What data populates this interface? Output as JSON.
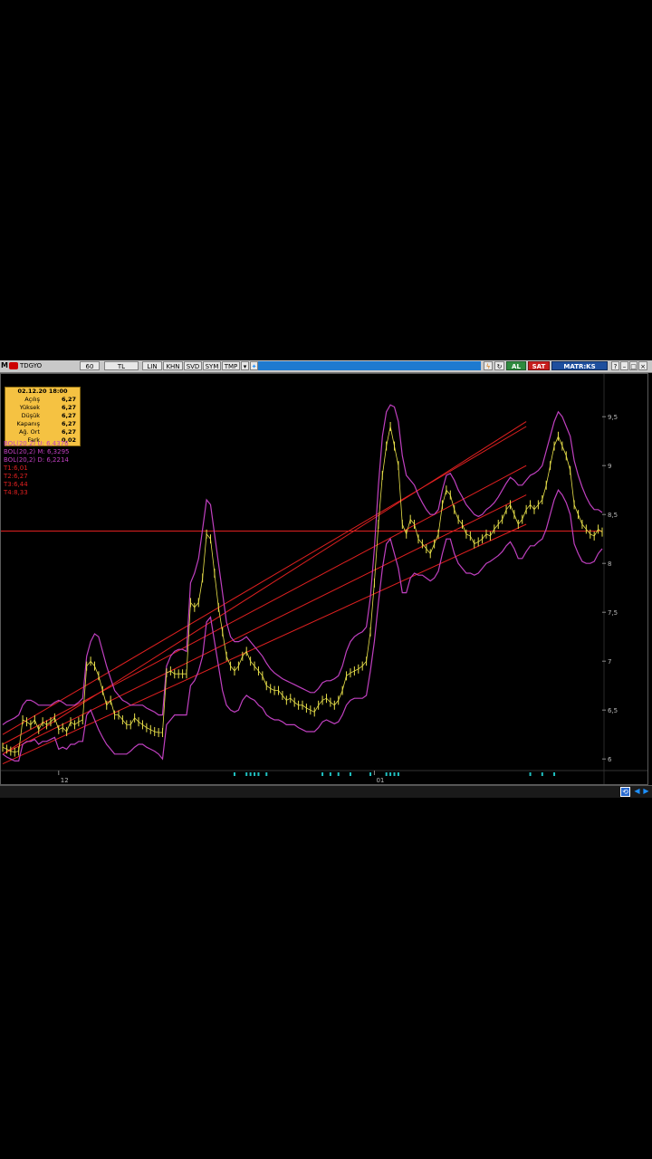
{
  "toolbar": {
    "symbol": "TDGYO",
    "period": "60",
    "currency": "TL",
    "buttons": [
      "LIN",
      "KHN",
      "SVD",
      "SYM",
      "TMP"
    ],
    "al": "AL",
    "sat": "SAT",
    "matrks": "MATR:KS"
  },
  "infobox": {
    "date": "02.12.20 18:00",
    "rows": [
      {
        "k": "Açılış",
        "v": "6,27"
      },
      {
        "k": "Yüksek",
        "v": "6,27"
      },
      {
        "k": "Düşük",
        "v": "6,27"
      },
      {
        "k": "Kapanış",
        "v": "6,27"
      },
      {
        "k": "Ağ. Ort",
        "v": "6,27"
      },
      {
        "k": "Fark",
        "v": "0,02"
      }
    ]
  },
  "indicators": [
    {
      "label": "BOL(20,2) U:",
      "value": "6,4376",
      "color": "#c040c0"
    },
    {
      "label": "BOL(20,2) M:",
      "value": "6,3295",
      "color": "#c040c0"
    },
    {
      "label": "BOL(20,2) D:",
      "value": "6,2214",
      "color": "#c040c0"
    },
    {
      "label": "T1:",
      "value": "6,01",
      "color": "#e02020"
    },
    {
      "label": "T2:",
      "value": "6,27",
      "color": "#e02020"
    },
    {
      "label": "T3:",
      "value": "6,44",
      "color": "#e02020"
    },
    {
      "label": "T4:",
      "value": "8,33",
      "color": "#e02020"
    }
  ],
  "chart_data": {
    "type": "line",
    "ylim": [
      5.9,
      9.9
    ],
    "yticks": [
      "9,5",
      "9",
      "8,5",
      "8",
      "7,5",
      "7",
      "6,5",
      "6"
    ],
    "ytick_values": [
      9.5,
      9.0,
      8.5,
      8.0,
      7.5,
      7.0,
      6.5,
      6.0
    ],
    "xtick_labels": [
      "12",
      "01"
    ],
    "xtick_index": [
      14,
      93
    ],
    "series": [
      {
        "name": "",
        "color": "#e8e04a",
        "values": [
          6.12,
          6.1,
          6.08,
          6.07,
          6.08,
          6.4,
          6.38,
          6.35,
          6.4,
          6.3,
          6.38,
          6.35,
          6.38,
          6.42,
          6.3,
          6.32,
          6.28,
          6.38,
          6.35,
          6.38,
          6.4,
          6.95,
          7.0,
          6.95,
          6.85,
          6.7,
          6.55,
          6.6,
          6.45,
          6.45,
          6.4,
          6.35,
          6.35,
          6.42,
          6.38,
          6.35,
          6.32,
          6.3,
          6.28,
          6.27,
          6.27,
          6.88,
          6.9,
          6.87,
          6.87,
          6.87,
          6.87,
          7.6,
          7.55,
          7.6,
          7.85,
          8.3,
          8.25,
          7.9,
          7.55,
          7.3,
          7.05,
          6.95,
          6.9,
          6.95,
          7.05,
          7.1,
          7.0,
          6.95,
          6.9,
          6.85,
          6.75,
          6.72,
          6.7,
          6.7,
          6.65,
          6.6,
          6.62,
          6.58,
          6.55,
          6.55,
          6.52,
          6.5,
          6.48,
          6.55,
          6.6,
          6.62,
          6.58,
          6.55,
          6.6,
          6.7,
          6.85,
          6.88,
          6.9,
          6.92,
          6.95,
          7.0,
          7.3,
          7.8,
          8.4,
          8.9,
          9.2,
          9.4,
          9.2,
          9.0,
          8.4,
          8.3,
          8.45,
          8.4,
          8.25,
          8.2,
          8.15,
          8.1,
          8.2,
          8.3,
          8.6,
          8.75,
          8.7,
          8.55,
          8.45,
          8.4,
          8.3,
          8.28,
          8.2,
          8.22,
          8.25,
          8.3,
          8.28,
          8.35,
          8.4,
          8.45,
          8.55,
          8.6,
          8.5,
          8.4,
          8.45,
          8.55,
          8.6,
          8.55,
          8.6,
          8.65,
          8.8,
          9.0,
          9.2,
          9.3,
          9.2,
          9.1,
          8.95,
          8.6,
          8.5,
          8.4,
          8.35,
          8.3,
          8.28,
          8.35,
          8.32
        ]
      },
      {
        "name": "",
        "color": "#c040c0",
        "values": [
          6.35,
          6.38,
          6.4,
          6.42,
          6.45,
          6.55,
          6.6,
          6.6,
          6.58,
          6.55,
          6.55,
          6.55,
          6.55,
          6.58,
          6.6,
          6.58,
          6.55,
          6.55,
          6.55,
          6.58,
          6.62,
          7.05,
          7.2,
          7.28,
          7.25,
          7.1,
          6.95,
          6.82,
          6.7,
          6.65,
          6.6,
          6.58,
          6.55,
          6.55,
          6.55,
          6.55,
          6.52,
          6.5,
          6.48,
          6.45,
          6.45,
          6.95,
          7.05,
          7.1,
          7.12,
          7.12,
          7.1,
          7.8,
          7.9,
          8.05,
          8.35,
          8.65,
          8.6,
          8.3,
          8.0,
          7.7,
          7.4,
          7.25,
          7.2,
          7.2,
          7.22,
          7.25,
          7.2,
          7.15,
          7.1,
          7.05,
          6.98,
          6.92,
          6.88,
          6.85,
          6.82,
          6.8,
          6.78,
          6.76,
          6.74,
          6.72,
          6.7,
          6.68,
          6.68,
          6.72,
          6.78,
          6.8,
          6.8,
          6.82,
          6.85,
          6.95,
          7.1,
          7.2,
          7.25,
          7.28,
          7.3,
          7.35,
          7.65,
          8.15,
          8.8,
          9.3,
          9.55,
          9.62,
          9.6,
          9.45,
          9.1,
          8.9,
          8.85,
          8.8,
          8.7,
          8.62,
          8.55,
          8.5,
          8.5,
          8.55,
          8.75,
          8.9,
          8.92,
          8.85,
          8.75,
          8.68,
          8.6,
          8.55,
          8.5,
          8.48,
          8.5,
          8.55,
          8.58,
          8.62,
          8.68,
          8.75,
          8.82,
          8.88,
          8.85,
          8.8,
          8.8,
          8.85,
          8.9,
          8.92,
          8.95,
          9.0,
          9.15,
          9.3,
          9.45,
          9.55,
          9.5,
          9.4,
          9.3,
          9.05,
          8.9,
          8.78,
          8.68,
          8.6,
          8.55,
          8.55,
          8.52
        ]
      },
      {
        "name": "",
        "color": "#c040c0",
        "values": [
          6.05,
          6.02,
          6.0,
          5.98,
          5.98,
          6.15,
          6.18,
          6.18,
          6.2,
          6.15,
          6.18,
          6.18,
          6.2,
          6.22,
          6.1,
          6.12,
          6.1,
          6.15,
          6.15,
          6.18,
          6.18,
          6.45,
          6.5,
          6.4,
          6.3,
          6.22,
          6.15,
          6.1,
          6.05,
          6.05,
          6.05,
          6.05,
          6.08,
          6.12,
          6.15,
          6.15,
          6.12,
          6.1,
          6.08,
          6.05,
          6.0,
          6.35,
          6.4,
          6.45,
          6.45,
          6.45,
          6.45,
          6.75,
          6.8,
          6.9,
          7.05,
          7.4,
          7.45,
          7.2,
          6.95,
          6.7,
          6.55,
          6.5,
          6.48,
          6.5,
          6.6,
          6.65,
          6.62,
          6.6,
          6.55,
          6.52,
          6.45,
          6.42,
          6.4,
          6.4,
          6.38,
          6.35,
          6.35,
          6.35,
          6.32,
          6.3,
          6.28,
          6.28,
          6.28,
          6.32,
          6.38,
          6.4,
          6.38,
          6.36,
          6.38,
          6.45,
          6.55,
          6.6,
          6.62,
          6.62,
          6.62,
          6.65,
          6.9,
          7.2,
          7.6,
          7.95,
          8.2,
          8.25,
          8.1,
          7.95,
          7.7,
          7.7,
          7.85,
          7.9,
          7.88,
          7.88,
          7.85,
          7.82,
          7.85,
          7.92,
          8.1,
          8.25,
          8.25,
          8.1,
          8.0,
          7.95,
          7.9,
          7.9,
          7.88,
          7.9,
          7.95,
          8.0,
          8.02,
          8.05,
          8.08,
          8.12,
          8.18,
          8.22,
          8.15,
          8.05,
          8.05,
          8.12,
          8.18,
          8.18,
          8.22,
          8.25,
          8.35,
          8.5,
          8.65,
          8.75,
          8.7,
          8.62,
          8.5,
          8.2,
          8.1,
          8.02,
          8.0,
          8.0,
          8.02,
          8.1,
          8.15
        ]
      }
    ],
    "hlines": [
      {
        "value": 8.33,
        "color": "#e02020"
      }
    ],
    "trendlines": [
      {
        "color": "#e02020",
        "from": [
          0,
          6.05
        ],
        "to": [
          131,
          9.45
        ]
      },
      {
        "color": "#e02020",
        "from": [
          0,
          6.05
        ],
        "to": [
          131,
          8.7
        ]
      },
      {
        "color": "#e02020",
        "from": [
          0,
          6.15
        ],
        "to": [
          131,
          9.0
        ]
      },
      {
        "color": "#e02020",
        "from": [
          0,
          5.95
        ],
        "to": [
          131,
          8.4
        ]
      },
      {
        "color": "#e02020",
        "from": [
          0,
          6.25
        ],
        "to": [
          131,
          9.4
        ]
      }
    ],
    "markers_x": [
      58,
      61,
      62,
      63,
      64,
      66,
      80,
      82,
      84,
      87,
      92,
      96,
      97,
      98,
      99,
      132,
      135,
      138
    ]
  }
}
